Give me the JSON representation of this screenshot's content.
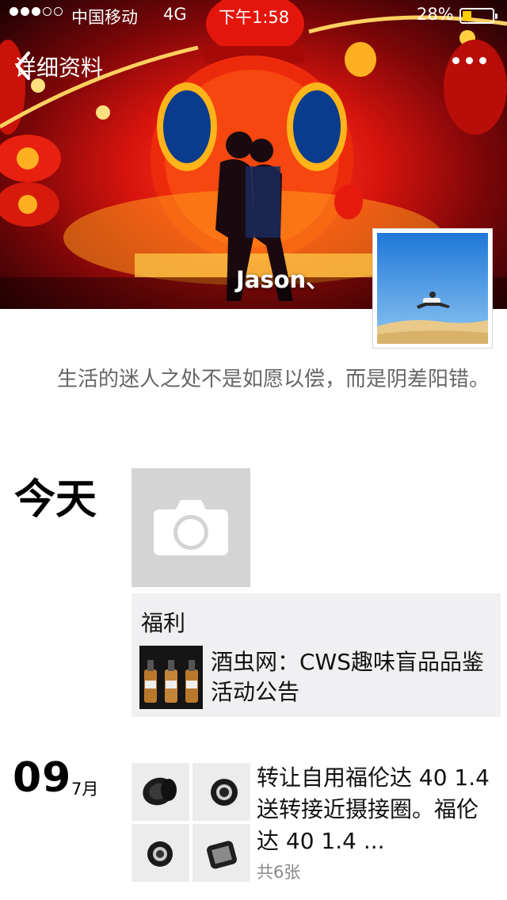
{
  "status_bar": {
    "carrier": "中国移动",
    "network": "4G",
    "time": "下午1:58",
    "battery_percent": "28%",
    "battery_level": 0.28,
    "signal_bars": 3
  },
  "nav": {
    "back_label": "详细资料",
    "back_icon": "chevron-left-icon",
    "more_icon": "more-dots-icon"
  },
  "profile": {
    "name": "Jason、",
    "signature": "生活的迷人之处不是如愿以偿，而是阴差阳错。"
  },
  "timeline": {
    "today": {
      "label": "今天",
      "camera_icon": "camera-icon",
      "share": {
        "label": "福利",
        "title": "酒虫网：CWS趣味盲品品鉴活动公告"
      }
    },
    "post": {
      "day": "09",
      "month": "7月",
      "text": "转让自用福伦达 40 1.4 送转接近摄接圈。福伦达 40 1.4 ...",
      "photo_count": "共6张"
    }
  },
  "colors": {
    "battery_fill": "#ffcc00",
    "card_bg": "#f0f0f2",
    "placeholder_bg": "#d4d4d4",
    "signature_text": "#666666"
  }
}
